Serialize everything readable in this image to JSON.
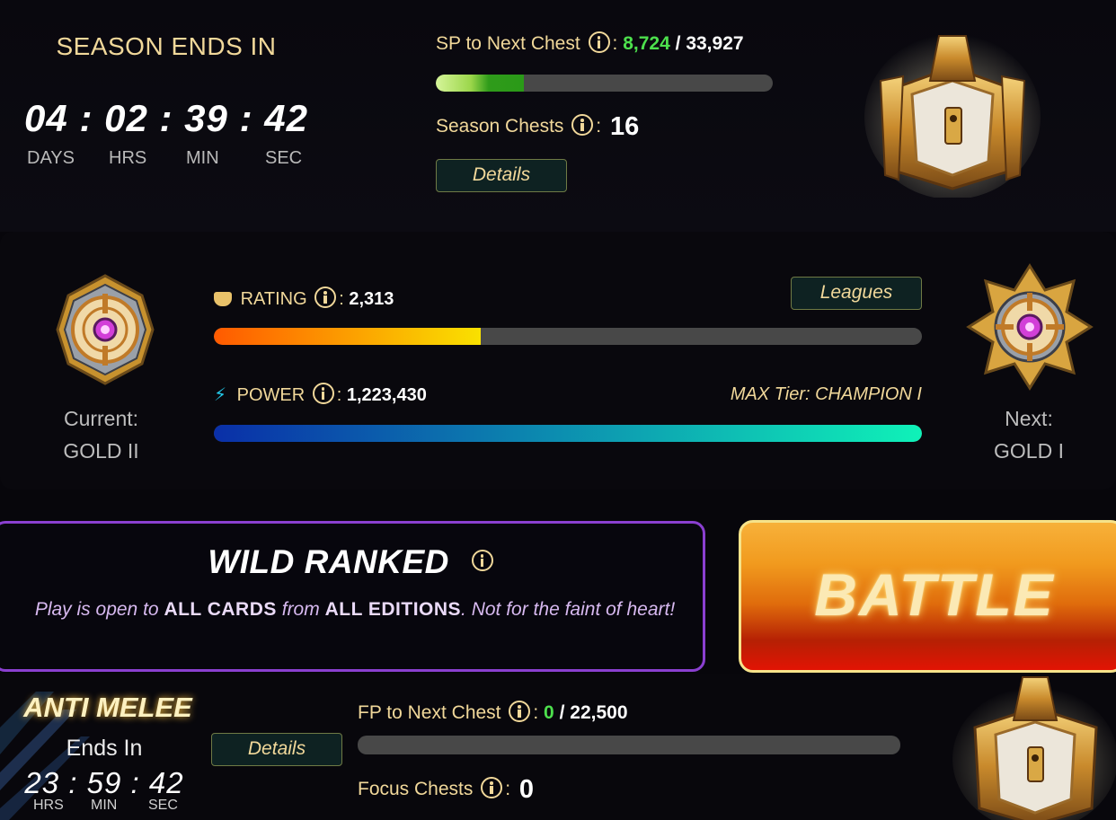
{
  "season": {
    "title": "SEASON ENDS IN",
    "timer": {
      "days": "04",
      "hrs": "02",
      "min": "39",
      "sec": "42"
    },
    "units": {
      "days": "DAYS",
      "hrs": "HRS",
      "min": "MIN",
      "sec": "SEC"
    },
    "sp_label": "SP to Next Chest",
    "sp_current": "8,724",
    "sp_total": "33,927",
    "sp_progress": 0.26,
    "chests_label": "Season Chests",
    "chests_count": "16",
    "details_label": "Details",
    "chest_icon": "season-chest-icon"
  },
  "league": {
    "current_label": "Current:",
    "current_rank": "GOLD II",
    "next_label": "Next:",
    "next_rank": "GOLD I",
    "rating_label": "RATING",
    "rating_value": "2,313",
    "rating_progress": 0.377,
    "leagues_label": "Leagues",
    "power_label": "POWER",
    "power_value": "1,223,430",
    "power_progress": 1.0,
    "max_tier": "MAX Tier: CHAMPION I",
    "colors": {
      "rating_bar": [
        "#ff5a00",
        "#f9e100"
      ],
      "power_bar": [
        "#0a2fa8",
        "#0ff2b8"
      ]
    }
  },
  "mode": {
    "title": "WILD RANKED",
    "desc_1": "Play is open to",
    "desc_2": "ALL CARDS",
    "desc_3": "from",
    "desc_4": "ALL EDITIONS",
    "desc_5": ". Not for the faint of heart!",
    "accent": "#8a3fd0"
  },
  "battle": {
    "label": "BATTLE"
  },
  "focus": {
    "title": "ANTI MELEE",
    "ends_in": "Ends In",
    "timer": {
      "hrs": "23",
      "min": "59",
      "sec": "42"
    },
    "units": {
      "hrs": "HRS",
      "min": "MIN",
      "sec": "SEC"
    },
    "details_label": "Details",
    "fp_label": "FP to Next Chest",
    "fp_current": "0",
    "fp_total": "22,500",
    "fp_progress": 0,
    "chests_label": "Focus Chests",
    "chests_count": "0",
    "chest_icon": "focus-chest-icon"
  }
}
